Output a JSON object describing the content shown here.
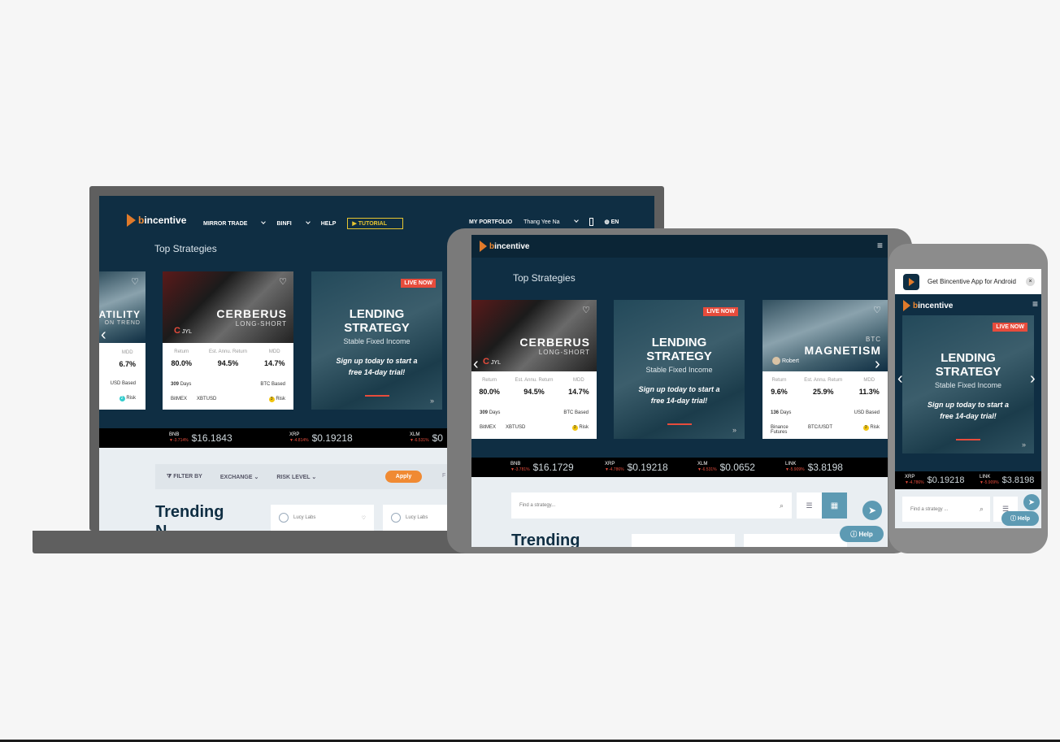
{
  "brand": {
    "name_prefix": "b",
    "name_rest": "incentive"
  },
  "laptop": {
    "nav": {
      "mirror_trade": "MIRROR TRADE",
      "binfi": "BINFI",
      "help": "HELP",
      "tutorial": "TUTORIAL",
      "my_portfolio": "MY PORTFOLIO",
      "user": "Thang Yee Na",
      "lang": "EN"
    },
    "section_title": "Top Strategies",
    "partial_card": {
      "name": "ATILITY",
      "sub": "ON TREND",
      "mdd_label": "MDD",
      "mdd": "6.7%",
      "based": "USD Based",
      "risk": "Risk",
      "risk_level": "2"
    },
    "card_cerberus": {
      "name": "CERBERUS",
      "sub": "LONG-SHORT",
      "author": "JYL",
      "return_label": "Return",
      "return": "80.0%",
      "annu_label": "Est. Annu. Return",
      "annu": "94.5%",
      "mdd_label": "MDD",
      "mdd": "14.7%",
      "days": "309",
      "days_label": "Days",
      "based": "BTC Based",
      "exchange": "BitMEX",
      "pair": "XBTUSD",
      "risk": "Risk",
      "risk_level": "3"
    },
    "lending": {
      "live": "LIVE NOW",
      "title_line1": "LENDING",
      "title_line2": "STRATEGY",
      "subtitle": "Stable Fixed Income",
      "cta_line1": "Sign up today to start a",
      "cta_line2": "free 14-day trial!"
    },
    "ticker": [
      {
        "sym": "BNB",
        "chg": "▼-3.714%",
        "price": "$16.1843"
      },
      {
        "sym": "XRP",
        "chg": "▼-4.814%",
        "price": "$0.19218"
      },
      {
        "sym": "XLM",
        "chg": "▼-6.531%",
        "price": "$0"
      }
    ],
    "filter": {
      "label": "FILTER BY",
      "exchange": "EXCHANGE",
      "risk": "RISK LEVEL",
      "apply": "Apply",
      "more": "F"
    },
    "trending": "Trending",
    "trending2": "N",
    "lucy": [
      "Lucy Labs",
      "Lucy Labs"
    ]
  },
  "tablet": {
    "section_title": "Top Strategies",
    "card_cerberus": {
      "name": "CERBERUS",
      "sub": "LONG-SHORT",
      "author": "JYL",
      "return_label": "Return",
      "return": "80.0%",
      "annu_label": "Est. Annu. Return",
      "annu": "94.5%",
      "mdd_label": "MDD",
      "mdd": "14.7%",
      "days": "309",
      "days_label": "Days",
      "based": "BTC Based",
      "exchange": "BitMEX",
      "pair": "XBTUSD",
      "risk": "Risk",
      "risk_level": "3"
    },
    "lending": {
      "live": "LIVE NOW",
      "title_line1": "LENDING",
      "title_line2": "STRATEGY",
      "subtitle": "Stable Fixed Income",
      "cta_line1": "Sign up today to start a",
      "cta_line2": "free 14-day trial!"
    },
    "card_magnetism": {
      "name": "MAGNETISM",
      "sub": "BTC",
      "author": "Robert",
      "return_label": "Return",
      "return": "9.6%",
      "annu_label": "Est. Annu. Return",
      "annu": "25.9%",
      "mdd_label": "MDD",
      "mdd": "11.3%",
      "days": "136",
      "days_label": "Days",
      "based": "USD Based",
      "exchange": "Binance Futures",
      "pair": "BTC/USDT",
      "risk": "Risk",
      "risk_level": "3"
    },
    "ticker": [
      {
        "sym": "BNB",
        "chg": "▼-3.781%",
        "price": "$16.1729"
      },
      {
        "sym": "XRP",
        "chg": "▼-4.786%",
        "price": "$0.19218"
      },
      {
        "sym": "XLM",
        "chg": "▼-6.531%",
        "price": "$0.0652"
      },
      {
        "sym": "LINK",
        "chg": "▼-5.909%",
        "price": "$3.8198"
      }
    ],
    "search_placeholder": "Find a strategy...",
    "trending": "Trending",
    "help": "Help"
  },
  "phone": {
    "banner": "Get Bincentive App for Android",
    "lending": {
      "live": "LIVE NOW",
      "title_line1": "LENDING",
      "title_line2": "STRATEGY",
      "subtitle": "Stable Fixed Income",
      "cta_line1": "Sign up today to start a",
      "cta_line2": "free 14-day trial!"
    },
    "ticker": [
      {
        "sym": "XRP",
        "chg": "▼-4.786%",
        "price": "$0.19218"
      },
      {
        "sym": "LINK",
        "chg": "▼-5.909%",
        "price": "$3.8198"
      }
    ],
    "search_placeholder": "Find a strategy ...",
    "help": "Help"
  }
}
